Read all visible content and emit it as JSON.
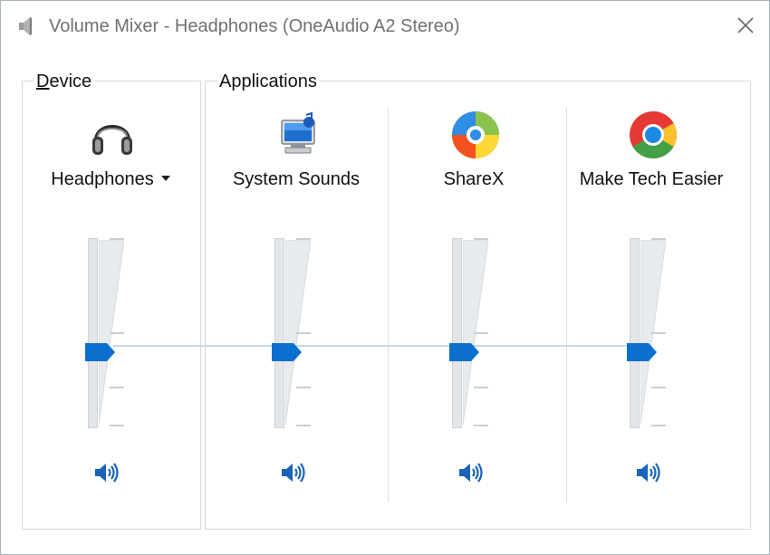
{
  "window": {
    "title": "Volume Mixer - Headphones (OneAudio A2 Stereo)"
  },
  "device": {
    "group_label_underlined": "D",
    "group_label_rest": "evice",
    "name": "Headphones",
    "icon": "headphones-icon",
    "volume_percent": 45
  },
  "applications": {
    "group_label": "Applications",
    "items": [
      {
        "name": "System Sounds",
        "icon": "system-sounds-icon",
        "volume_percent": 45
      },
      {
        "name": "ShareX",
        "icon": "sharex-icon",
        "volume_percent": 45
      },
      {
        "name": "Make Tech Easier",
        "icon": "chrome-icon",
        "volume_percent": 45
      }
    ]
  },
  "colors": {
    "thumb": "#0a6fcf",
    "speaker": "#1a63b8",
    "track": "#e3e6e9"
  }
}
